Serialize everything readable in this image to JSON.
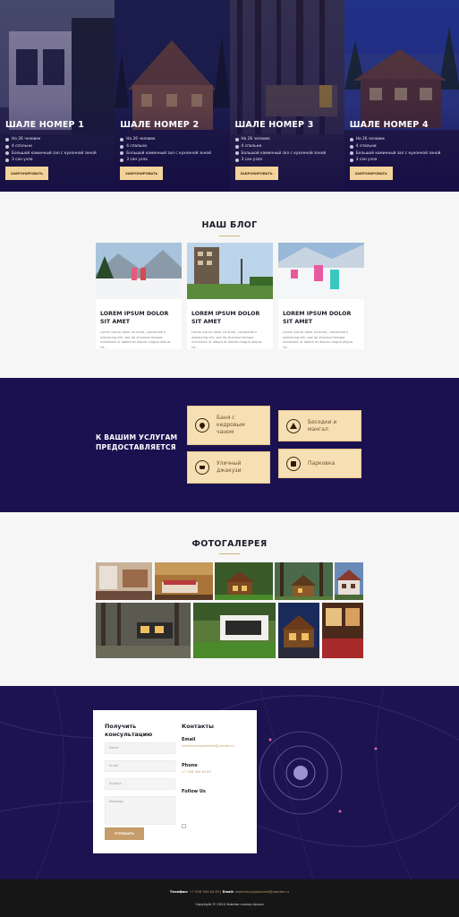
{
  "chalets": [
    {
      "title": "ШАЛЕ НОМЕР 1",
      "features": [
        "На 26 человек",
        "4 спальни",
        "Большой каминный зал с кухонной зоной",
        "3 сан узла"
      ],
      "button": "ЗАБРОНИРОВАТЬ"
    },
    {
      "title": "ШАЛЕ НОМЕР 2",
      "features": [
        "На 26 человек",
        "4 спальни",
        "Большой каминный зал с кухонной зоной",
        "3 сан узла"
      ],
      "button": "ЗАБРОНИРОВАТЬ"
    },
    {
      "title": "ШАЛЕ НОМЕР 3",
      "features": [
        "На 26 человек",
        "4 спальни",
        "Большой каминный зал с кухонной зоной",
        "3 сан узла"
      ],
      "button": "ЗАБРОНИРОВАТЬ"
    },
    {
      "title": "ШАЛЕ НОМЕР 4",
      "features": [
        "На 26 человек",
        "4 спальни",
        "Большой каминный зал с кухонной зоной",
        "3 сан узла"
      ],
      "button": "ЗАБРОНИРОВАТЬ"
    }
  ],
  "feature_icons": [
    "user-icon",
    "bed-icon",
    "fire-icon",
    "bath-icon"
  ],
  "blog": {
    "title": "НАШ БЛОГ",
    "posts": [
      {
        "title": "LOREM IPSUM DOLOR SIT AMET",
        "text": "Lorem ipsum dolor sit amet, consectetur adipiscing elit, sed do eiusmod tempor incididunt ut labore et dolore magna aliqua. Ut..."
      },
      {
        "title": "LOREM IPSUM DOLOR SIT AMET",
        "text": "Lorem ipsum dolor sit amet, consectetur adipiscing elit, sed do eiusmod tempor incididunt ut labore et dolore magna aliqua. Ut..."
      },
      {
        "title": "LOREM IPSUM DOLOR SIT AMET",
        "text": "Lorem ipsum dolor sit amet, consectetur adipiscing elit, sed do eiusmod tempor incididunt ut labore et dolore magna aliqua. Ut..."
      }
    ]
  },
  "services": {
    "lead": "К ВАШИМ УСЛУГАМ ПРЕДОСТАВЛЯЕТСЯ",
    "items": [
      {
        "label": "Баня с кедровым чаном",
        "icon": "drop-icon"
      },
      {
        "label": "Беседки и мангал",
        "icon": "tent-icon"
      },
      {
        "label": "Уличный джакузи",
        "icon": "bath-icon"
      },
      {
        "label": "Парковка",
        "icon": "parking-icon"
      }
    ]
  },
  "gallery": {
    "title": "ФОТОГАЛЕРЕЯ"
  },
  "contact": {
    "form_title": "Получить консультацию",
    "name_placeholder": "Name",
    "email_placeholder": "Email",
    "subject_placeholder": "Subject",
    "message_placeholder": "Message",
    "send_button": "ОТПРАВИТЬ",
    "contacts_title": "Контакты",
    "email_label": "Email",
    "email_value": "shaleminyayaskazka@yandex.ru",
    "phone_label": "Phone",
    "phone_value": "+7 928 384 84 63",
    "follow_label": "Follow Us"
  },
  "footer": {
    "phone_label": "Телефон:",
    "phone_value": "+7 928 384 84 63",
    "email_label": "Email:",
    "email_value": "shaleminyayaskazka@yandex.ru",
    "copyright": "Copyright © 2024 Зимняя сказка Архыз"
  },
  "colors": {
    "navy": "#1b1150",
    "accent": "#f2d39a",
    "service_tile": "#f6dfb3",
    "button_brown": "#c69c6a"
  }
}
